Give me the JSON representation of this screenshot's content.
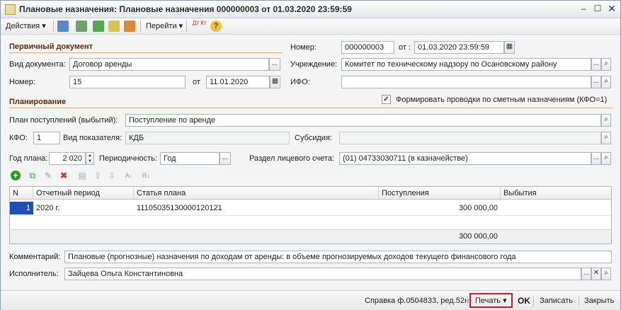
{
  "window": {
    "title": "Плановые назначения: Плановые назначения 000000003 от 01.03.2020 23:59:59"
  },
  "toolbar": {
    "actions_label": "Действия",
    "goto_label": "Перейти",
    "dtkt_label": "Дт Кт",
    "help_label": "?"
  },
  "primary": {
    "section_title": "Первичный документ",
    "doc_type_label": "Вид документа:",
    "doc_type_value": "Договор аренды",
    "num_label": "Номер:",
    "num_value": "15",
    "date_label": "от",
    "date_value": "11.01.2020"
  },
  "header": {
    "number_label": "Номер:",
    "number_value": "000000003",
    "from_label": "от :",
    "from_value": "01.03.2020 23:59:59",
    "institution_label": "Учреждение:",
    "institution_value": "Комитет по техническому надзору по Осановскому району",
    "ifo_label": "ИФО:",
    "ifo_value": ""
  },
  "planning": {
    "section_title": "Планирование",
    "form_entries_label": "Формировать проводки по сметным назначениям (КФО=1)",
    "form_entries_checked": "✓",
    "plan_label": "План поступлений (выбытий):",
    "plan_value": "Поступление по аренде",
    "kfo_label": "КФО:",
    "kfo_value": "1",
    "indicator_label": "Вид показателя:",
    "indicator_value": "КДБ",
    "subsidy_label": "Субсидия:",
    "subsidy_value": "",
    "year_label": "Год плана:",
    "year_value": "2 020",
    "period_label": "Периодичность:",
    "period_value": "Год",
    "account_label": "Раздел лицевого счета:",
    "account_value": "(01) 04733030711 (в казначействе)"
  },
  "table": {
    "columns": [
      "N",
      "Отчетный период",
      "Статья плана",
      "Поступления",
      "Выбытия"
    ],
    "rows": [
      {
        "n": "1",
        "period": "2020 г.",
        "item": "11105035130000120121",
        "income": "300 000,00",
        "expense": ""
      }
    ],
    "total_income": "300 000,00"
  },
  "comment": {
    "label": "Комментарий:",
    "value": "Плановые (прогнозные) назначения по доходам от аренды: в объеме прогнозируемых доходов текущего финансового года"
  },
  "executor": {
    "label": "Исполнитель:",
    "value": "Зайцева Ольга Константиновна"
  },
  "bottom": {
    "report_label": "Справка ф.0504833, ред.52н",
    "print_label": "Печать",
    "ok_label": "OK",
    "save_label": "Записать",
    "close_label": "Закрыть"
  },
  "colors": {
    "section_title": "#5b2d0b",
    "print_highlight": "#c0202a",
    "add_icon": "#2e9a2e",
    "delete_icon": "#d23b2b",
    "selected_row": "#1f4fb3"
  }
}
